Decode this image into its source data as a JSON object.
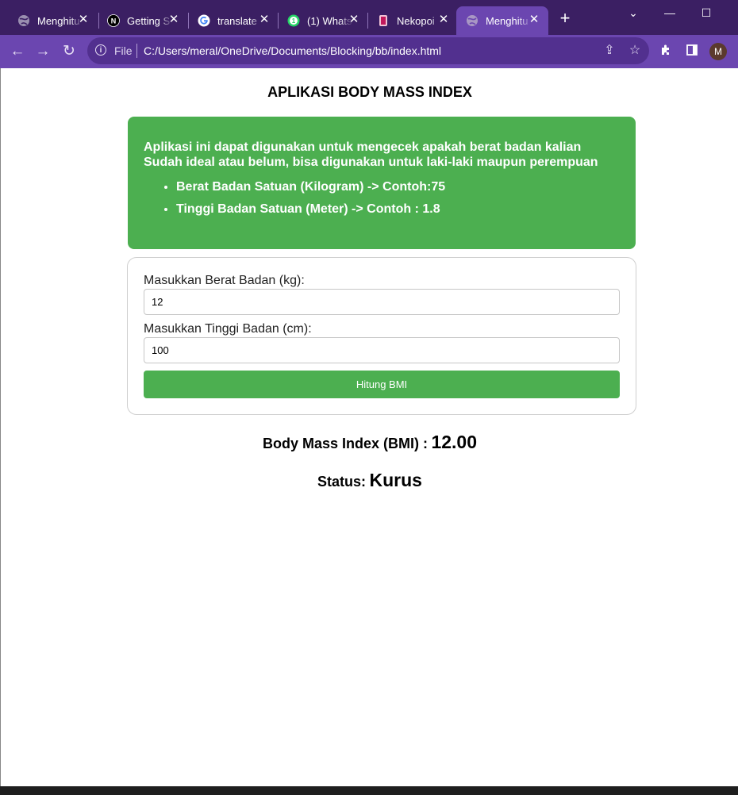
{
  "browser": {
    "tabs": [
      {
        "title": "Menghitu",
        "icon": "globe-icon",
        "active": false
      },
      {
        "title": "Getting S",
        "icon": "nextjs-icon",
        "active": false
      },
      {
        "title": "translate",
        "icon": "google-icon",
        "active": false
      },
      {
        "title": "(1) Whats",
        "icon": "whatsapp-icon",
        "active": false
      },
      {
        "title": "Nekopoi",
        "icon": "nekopoi-icon",
        "active": false
      },
      {
        "title": "Menghitu",
        "icon": "globe-icon",
        "active": true
      }
    ],
    "address": {
      "scheme_label": "File",
      "url": "C:/Users/meral/OneDrive/Documents/Blocking/bb/index.html"
    },
    "profile_initial": "M",
    "colors": {
      "tabbar": "#3b1f63",
      "toolbar": "#6b46b0",
      "accent_green": "#4caf50"
    }
  },
  "page": {
    "heading": "APLIKASI BODY MASS INDEX",
    "info": {
      "text": "Aplikasi ini dapat digunakan untuk mengecek apakah berat badan kalian Sudah ideal atau belum, bisa digunakan untuk laki-laki maupun perempuan",
      "items": [
        "Berat Badan Satuan (Kilogram) -> Contoh:75",
        "Tinggi Badan Satuan (Meter) -> Contoh : 1.8"
      ]
    },
    "form": {
      "weight_label": "Masukkan Berat Badan (kg):",
      "weight_value": "12",
      "height_label": "Masukkan Tinggi Badan (cm):",
      "height_value": "100",
      "button_label": "Hitung BMI"
    },
    "result": {
      "bmi_label": "Body Mass Index (BMI) :",
      "bmi_value": "12.00",
      "status_label": "Status:",
      "status_value": "Kurus"
    }
  }
}
